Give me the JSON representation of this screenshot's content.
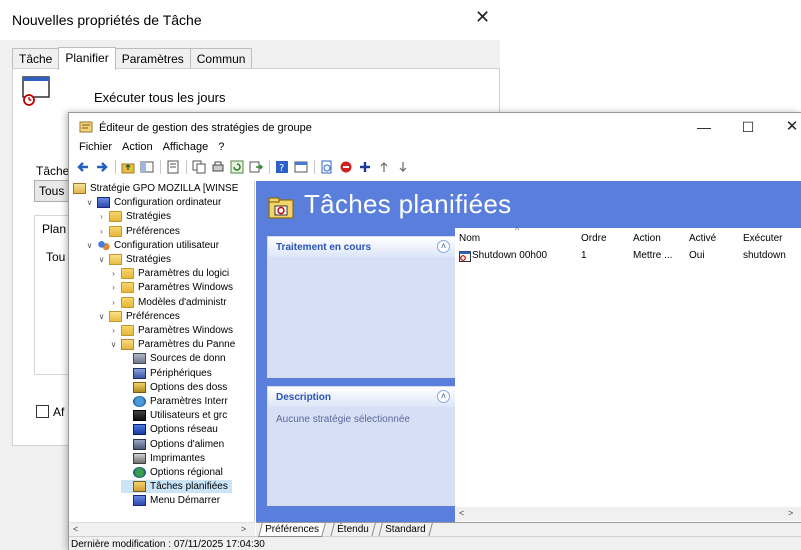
{
  "dialog": {
    "title": "Nouvelles propriétés de Tâche",
    "close_label": "✕",
    "tabs": [
      {
        "label": "Tâche",
        "active": false
      },
      {
        "label": "Planifier",
        "active": true
      },
      {
        "label": "Paramètres",
        "active": false
      },
      {
        "label": "Commun",
        "active": false
      }
    ],
    "schedule_summary": "Exécuter tous les jours",
    "task_label_partial": "Tâche",
    "schedule_select_partial": "Tous",
    "plan_group_partial": "Plan",
    "plan_value_partial": "Tou",
    "checkbox_label_partial": "Af"
  },
  "editor": {
    "title": "Éditeur de gestion des stratégies de groupe",
    "window_buttons": {
      "minimize": "—",
      "maximize": "☐",
      "close": "✕"
    },
    "menu": [
      "Fichier",
      "Action",
      "Affichage",
      "?"
    ],
    "tree": [
      {
        "label": "Stratégie GPO MOZILLA [WINSE",
        "arrow": "",
        "icon": "gpo-scroll-icon",
        "indent": 0
      },
      {
        "label": "Configuration ordinateur",
        "arrow": "v",
        "icon": "computer-icon",
        "indent": 1
      },
      {
        "label": "Stratégies",
        "arrow": ">",
        "icon": "folder-icon",
        "indent": 2
      },
      {
        "label": "Préférences",
        "arrow": ">",
        "icon": "folder-icon",
        "indent": 2
      },
      {
        "label": "Configuration utilisateur",
        "arrow": "v",
        "icon": "users-icon",
        "indent": 1
      },
      {
        "label": "Stratégies",
        "arrow": "v",
        "icon": "folder-icon",
        "indent": 2
      },
      {
        "label": "Paramètres du logici",
        "arrow": ">",
        "icon": "folder-icon",
        "indent": 3
      },
      {
        "label": "Paramètres Windows",
        "arrow": ">",
        "icon": "folder-icon",
        "indent": 3
      },
      {
        "label": "Modèles d'administr",
        "arrow": ">",
        "icon": "folder-icon",
        "indent": 3
      },
      {
        "label": "Préférences",
        "arrow": "v",
        "icon": "folder-icon",
        "indent": 2
      },
      {
        "label": "Paramètres Windows",
        "arrow": ">",
        "icon": "folder-icon",
        "indent": 3
      },
      {
        "label": "Paramètres du Panne",
        "arrow": "v",
        "icon": "control-panel-folder-icon",
        "indent": 3
      },
      {
        "label": "Sources de donn",
        "arrow": "",
        "icon": "data-sources-icon",
        "indent": 4
      },
      {
        "label": "Périphériques",
        "arrow": "",
        "icon": "devices-icon",
        "indent": 4
      },
      {
        "label": "Options des doss",
        "arrow": "",
        "icon": "folder-options-icon",
        "indent": 4
      },
      {
        "label": "Paramètres Interr",
        "arrow": "",
        "icon": "internet-settings-icon",
        "indent": 4
      },
      {
        "label": "Utilisateurs et grc",
        "arrow": "",
        "icon": "local-users-icon",
        "indent": 4
      },
      {
        "label": "Options réseau",
        "arrow": "",
        "icon": "network-options-icon",
        "indent": 4
      },
      {
        "label": "Options d'alimen",
        "arrow": "",
        "icon": "power-options-icon",
        "indent": 4
      },
      {
        "label": "Imprimantes",
        "arrow": "",
        "icon": "printers-icon",
        "indent": 4
      },
      {
        "label": "Options régional",
        "arrow": "",
        "icon": "regional-options-icon",
        "indent": 4
      },
      {
        "label": "Tâches planifiées",
        "arrow": "",
        "icon": "scheduled-tasks-icon",
        "indent": 4,
        "selected": true
      },
      {
        "label": "Menu Démarrer",
        "arrow": "",
        "icon": "start-menu-icon",
        "indent": 4
      }
    ],
    "pane_title": "Tâches planifiées",
    "panel_processing": {
      "title": "Traitement en cours",
      "toggle": "˄"
    },
    "panel_description": {
      "title": "Description",
      "toggle": "˄",
      "text": "Aucune stratégie sélectionnée"
    },
    "columns": [
      "Nom",
      "Ordre",
      "Action",
      "Activé",
      "Exécuter"
    ],
    "rows": [
      {
        "name": "Shutdown 00h00",
        "order": "1",
        "action": "Mettre ...",
        "enabled": "Oui",
        "run": "shutdown"
      }
    ],
    "bottom_tabs": [
      "Préférences",
      "Étendu",
      "Standard"
    ],
    "status": "Dernière modification : 07/11/2025 17:04:30",
    "colors": {
      "pane_background": "#5a7edc",
      "panel_title": "#2a55b6",
      "selection": "#cce4f7"
    }
  }
}
